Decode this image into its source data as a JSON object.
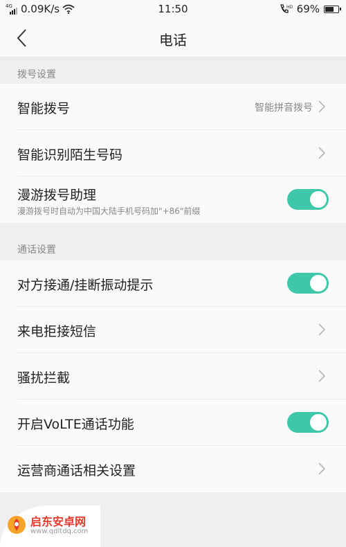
{
  "status_bar": {
    "network_type": "4G",
    "speed": "0.09K/s",
    "time": "11:50",
    "battery": "69%",
    "battery_level": 0.69
  },
  "header": {
    "title": "电话"
  },
  "sections": [
    {
      "title": "拨号设置",
      "rows": [
        {
          "label": "智能拨号",
          "value": "智能拼音拨号",
          "control": "chevron"
        },
        {
          "label": "智能识别陌生号码",
          "control": "chevron"
        },
        {
          "label": "漫游拨号助理",
          "sub": "漫游拨号时自动为中国大陆手机号码加\"+86\"前缀",
          "control": "toggle",
          "on": true
        }
      ]
    },
    {
      "title": "通话设置",
      "rows": [
        {
          "label": "对方接通/挂断振动提示",
          "control": "toggle",
          "on": true
        },
        {
          "label": "来电拒接短信",
          "control": "chevron"
        },
        {
          "label": "骚扰拦截",
          "control": "chevron"
        },
        {
          "label": "开启VoLTE通话功能",
          "control": "toggle",
          "on": true
        },
        {
          "label": "运营商通话相关设置",
          "control": "chevron"
        }
      ]
    }
  ],
  "watermark": {
    "name": "启东安卓网",
    "url": "www.qdltdq.com"
  },
  "colors": {
    "toggle_on": "#3ec7a9",
    "watermark_red": "#e23b2e"
  }
}
